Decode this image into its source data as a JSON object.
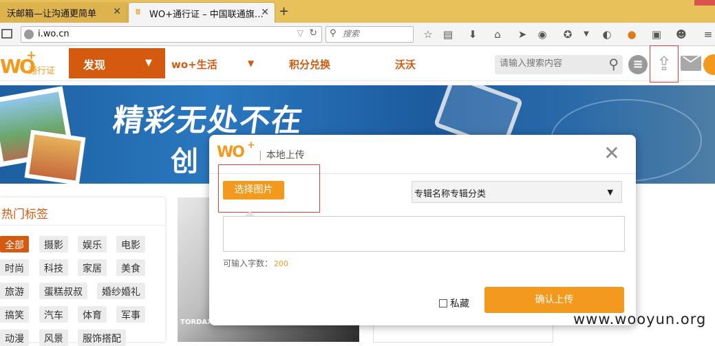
{
  "browser": {
    "tabs": [
      {
        "label": "沃邮箱—让沟通更简单",
        "active": false
      },
      {
        "label": "WO+通行证 – 中国联通旗…",
        "active": true
      }
    ],
    "new_tab": "+",
    "url": "i.wo.cn",
    "search_placeholder": "搜索"
  },
  "site": {
    "logo_text": "WO",
    "logo_plus": "+",
    "logo_sub": "通行证",
    "nav": {
      "discover": "发现",
      "life": "wo+生活",
      "points": "积分兑换",
      "wowo": "沃沃"
    },
    "search_placeholder": "请输入搜索内容"
  },
  "banner": {
    "title": "精彩无处不在",
    "subtitle": "创"
  },
  "hot_tags": {
    "title": "热门标签",
    "tags": [
      "全部",
      "摄影",
      "娱乐",
      "电影",
      "时尚",
      "科技",
      "家居",
      "美食",
      "旅游",
      "蛋糕叔叔",
      "婚纱婚礼",
      "搞笑",
      "汽车",
      "体育",
      "军事",
      "动漫",
      "风景",
      "服饰搭配"
    ]
  },
  "background": {
    "card_label": "TORDAX"
  },
  "modal": {
    "logo_text": "WO",
    "logo_plus": "+",
    "title_sep": "|",
    "title": "本地上传",
    "close": "✕",
    "choose_label": "选择图片",
    "album_label": "专辑名称专辑分类",
    "char_label": "可输入字数：",
    "char_count": "200",
    "private_label": "私藏",
    "confirm_label": "确认上传"
  },
  "watermark": "www.wooyun.org",
  "colors": {
    "brand_orange": "#f39a1e",
    "nav_orange": "#d45a10",
    "highlight_red": "#e23b3b",
    "tab_bar": "#e9c15a"
  }
}
